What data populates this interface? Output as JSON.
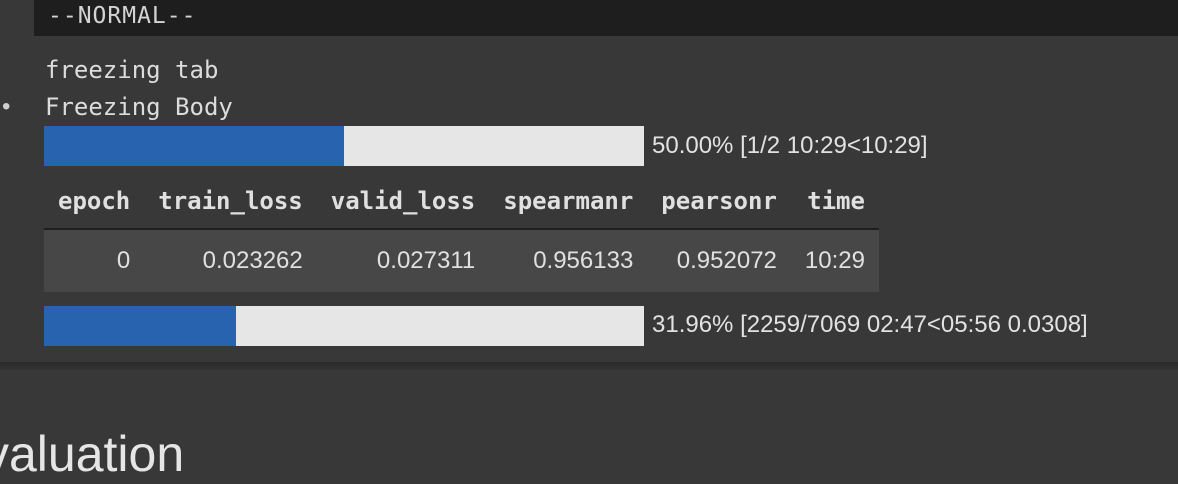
{
  "statusbar": {
    "mode": "--NORMAL--"
  },
  "output": {
    "bullet": "•",
    "line1": "freezing tab",
    "line2": "Freezing Body",
    "epoch_progress": {
      "fraction": 0.5,
      "text": "50.00% [1/2 10:29<10:29]"
    },
    "batch_progress": {
      "fraction": 0.3196,
      "text": "31.96% [2259/7069 02:47<05:56 0.0308]"
    },
    "table": {
      "headers": [
        "epoch",
        "train_loss",
        "valid_loss",
        "spearmanr",
        "pearsonr",
        "time"
      ],
      "rows": [
        [
          "0",
          "0.023262",
          "0.027311",
          "0.956133",
          "0.952072",
          "10:29"
        ]
      ]
    }
  },
  "next_section": {
    "heading": "valuation"
  },
  "colors": {
    "progress_fill": "#2863b0",
    "progress_track": "#e6e6e6",
    "background": "#383838"
  }
}
